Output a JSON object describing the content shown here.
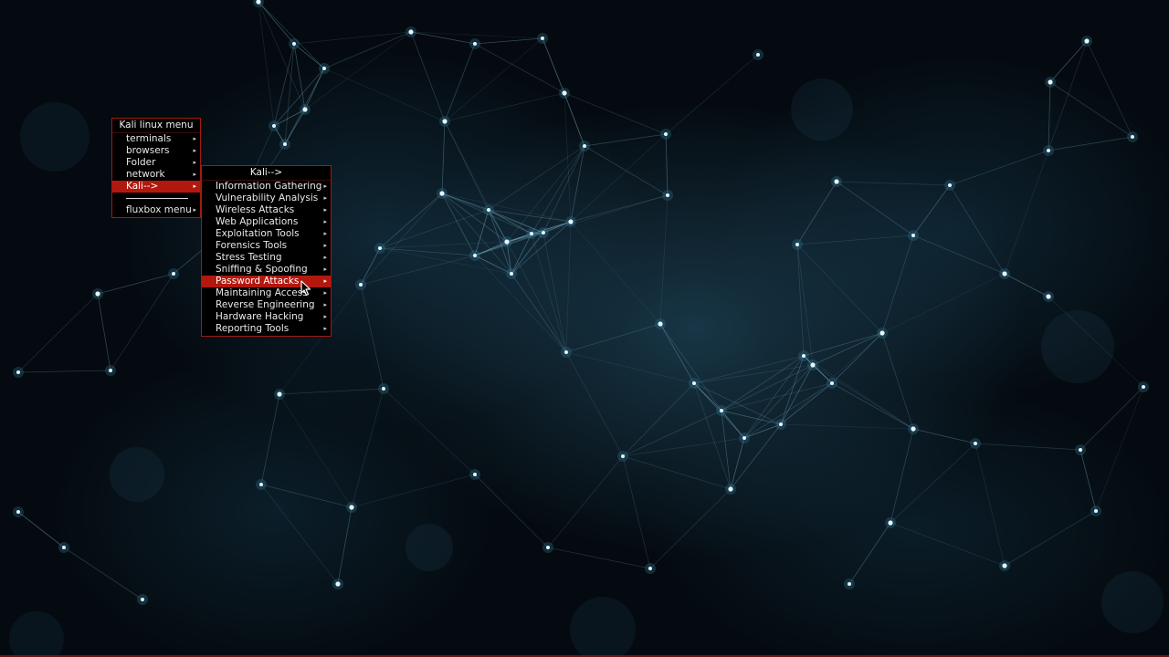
{
  "main_menu": {
    "title": "Kali linux menu",
    "items": [
      {
        "label": "terminals",
        "submenu": true
      },
      {
        "label": "browsers",
        "submenu": true
      },
      {
        "label": "Folder",
        "submenu": true
      },
      {
        "label": "network",
        "submenu": true
      },
      {
        "label": "Kali-->",
        "submenu": true,
        "active": true
      }
    ],
    "footer_item": {
      "label": "fluxbox menu",
      "submenu": true
    }
  },
  "kali_menu": {
    "title": "Kali-->",
    "items": [
      {
        "label": "Information Gathering",
        "submenu": true
      },
      {
        "label": "Vulnerability Analysis",
        "submenu": true
      },
      {
        "label": "Wireless Attacks",
        "submenu": true
      },
      {
        "label": "Web Applications",
        "submenu": true
      },
      {
        "label": "Exploitation Tools",
        "submenu": true
      },
      {
        "label": "Forensics Tools",
        "submenu": true
      },
      {
        "label": "Stress Testing",
        "submenu": true
      },
      {
        "label": "Sniffing & Spoofing",
        "submenu": true
      },
      {
        "label": "Password Attacks",
        "submenu": true,
        "active": true
      },
      {
        "label": "Maintaining Access",
        "submenu": true
      },
      {
        "label": "Reverse Engineering",
        "submenu": true
      },
      {
        "label": "Hardware Hacking",
        "submenu": true
      },
      {
        "label": "Reporting Tools",
        "submenu": true
      }
    ]
  },
  "submenu_arrow": "▸",
  "colors": {
    "menu_background": "#000000",
    "menu_border": "#9e1b12",
    "highlight": "#b3180e",
    "menu_text": "#e8e8e8",
    "wallpaper_dark": "#040a0f",
    "wallpaper_glow": "#2f6f8c",
    "node_color": "#e6f4fb"
  },
  "wallpaper": {
    "theme": "plexus-network-nodes"
  }
}
